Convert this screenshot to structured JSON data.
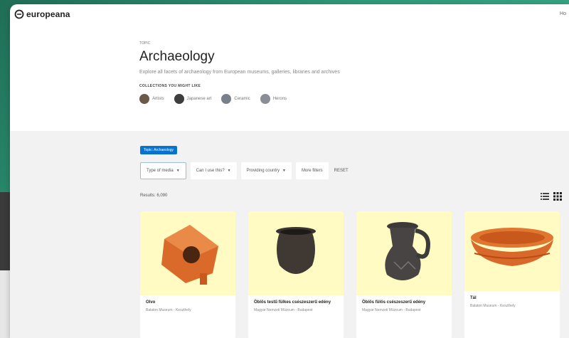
{
  "app": {
    "name": "europeana",
    "top_right": "Ho"
  },
  "header": {
    "crumb": "TOPIC",
    "title": "Archaeology",
    "description": "Explore all facets of archaeology from European museums, galleries, libraries and archives",
    "collections_label": "COLLECTIONS YOU MIGHT LIKE",
    "collections": [
      {
        "label": "Artists",
        "color": "#6b5a4a"
      },
      {
        "label": "Japanese art",
        "color": "#3d3d3d"
      },
      {
        "label": "Ceramic",
        "color": "#7a7f8c"
      },
      {
        "label": "Herons",
        "color": "#8a8f96"
      }
    ]
  },
  "main": {
    "badge": "Topic: Archaeology",
    "filters": [
      {
        "label": "Type of media",
        "active": true
      },
      {
        "label": "Can I use this?",
        "active": false
      },
      {
        "label": "Providing country",
        "active": false
      },
      {
        "label": "More filters",
        "active": false
      }
    ],
    "reset_label": "RESET",
    "results": "Results: 6,090"
  },
  "cards": [
    {
      "title": "Olvo",
      "subtitle": "Balaton Museum - Keszthely"
    },
    {
      "title": "Öblös testű fülkes csészeszerű edény",
      "subtitle": "Magyar Nemzeti Múzeum - Budapest"
    },
    {
      "title": "Öblös fülös csészeszerű edény",
      "subtitle": "Magyar Nemzeti Múzeum - Budapest"
    },
    {
      "title": "Tál",
      "subtitle": "Balaton Museum - Keszthely"
    }
  ],
  "colors": {
    "accent": "#0a72cc",
    "card_bg": "#fffbc2",
    "page_bg": "#f2f2f2"
  },
  "icons": [
    "logo-icon",
    "list-view-icon",
    "grid-view-icon",
    "chevron-down-icon"
  ]
}
